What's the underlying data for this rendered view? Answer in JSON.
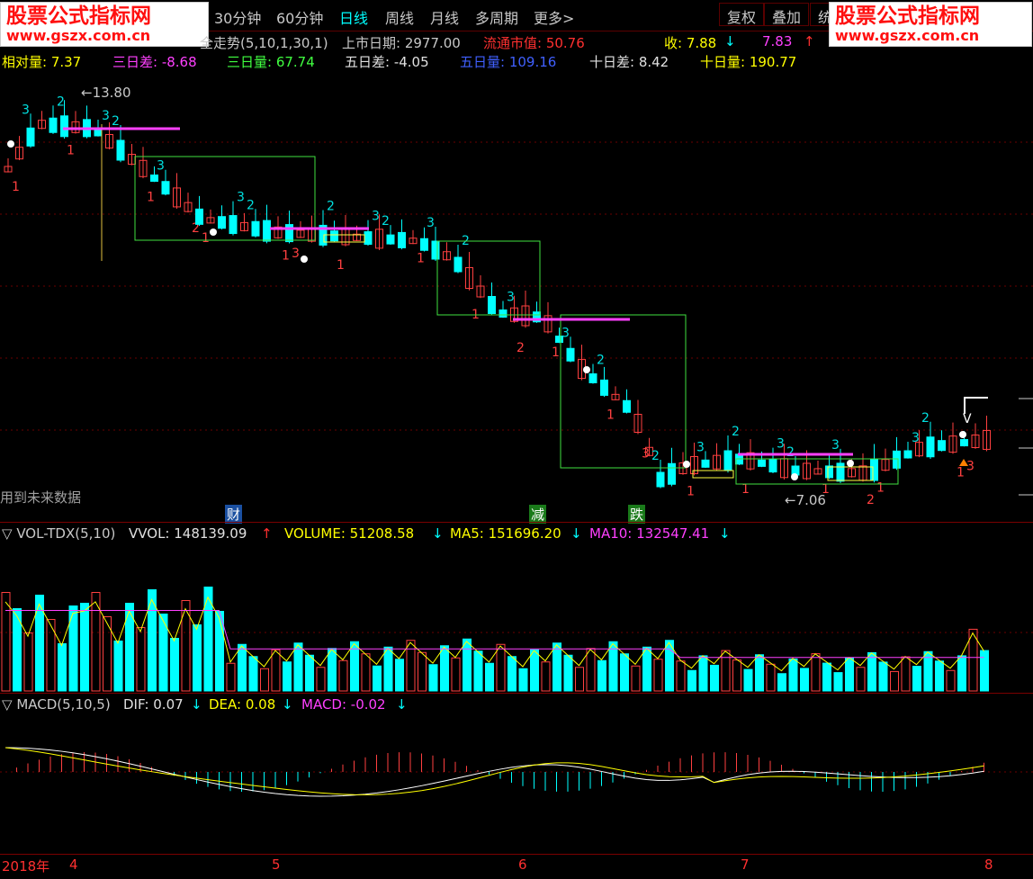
{
  "toolbar": {
    "periods": [
      "30分钟",
      "60分钟",
      "日线",
      "周线",
      "月线",
      "多周期",
      "更多>"
    ],
    "active_period": "日线",
    "buttons": [
      "复权",
      "叠加",
      "统"
    ]
  },
  "watermark": {
    "title": "股票公式指标网",
    "url": "www.gszx.com.cn"
  },
  "indicator_line": {
    "name": "全走势(5,10,1,30,1)",
    "list_date_label": "上市日期: 2977.00",
    "float_value_label": "流通市值: 50.76",
    "close_label": "收: 7.88",
    "close2": "7.83"
  },
  "indicator_line2": {
    "rel": "相对量: 7.37",
    "d3_diff": "三日差: -8.68",
    "d3_vol": "三日量: 67.74",
    "d5_diff": "五日差: -4.05",
    "d5_vol": "五日量: 109.16",
    "d10_diff": "十日差: 8.42",
    "d10_vol": "十日量: 190.77"
  },
  "main_chart": {
    "high_label": "13.80",
    "low_label": "7.06",
    "future_note": "用到未来数据",
    "markers": [
      {
        "text": "财",
        "color": "#1a4fa0"
      },
      {
        "text": "减",
        "color": "#1a7a1a"
      },
      {
        "text": "跌",
        "color": "#1a7a1a"
      }
    ],
    "corner_v": "V"
  },
  "volume_panel": {
    "name": "VOL-TDX(5,10)",
    "vvol": "VVOL: 148139.09",
    "volume": "VOLUME: 51208.58",
    "ma5": "MA5: 151696.20",
    "ma10": "MA10: 132547.41"
  },
  "macd_panel": {
    "name": "MACD(5,10,5)",
    "dif": "DIF: 0.07",
    "dea": "DEA: 0.08",
    "macd": "MACD: -0.02"
  },
  "date_axis": [
    "2018年",
    "4",
    "5",
    "6",
    "7",
    "8"
  ],
  "colors": {
    "up": "#ff4040",
    "down": "#00ffff",
    "ma5": "#ffff00",
    "ma10": "#ff40ff",
    "box": "#40e040",
    "grid": "#6a0000"
  }
}
